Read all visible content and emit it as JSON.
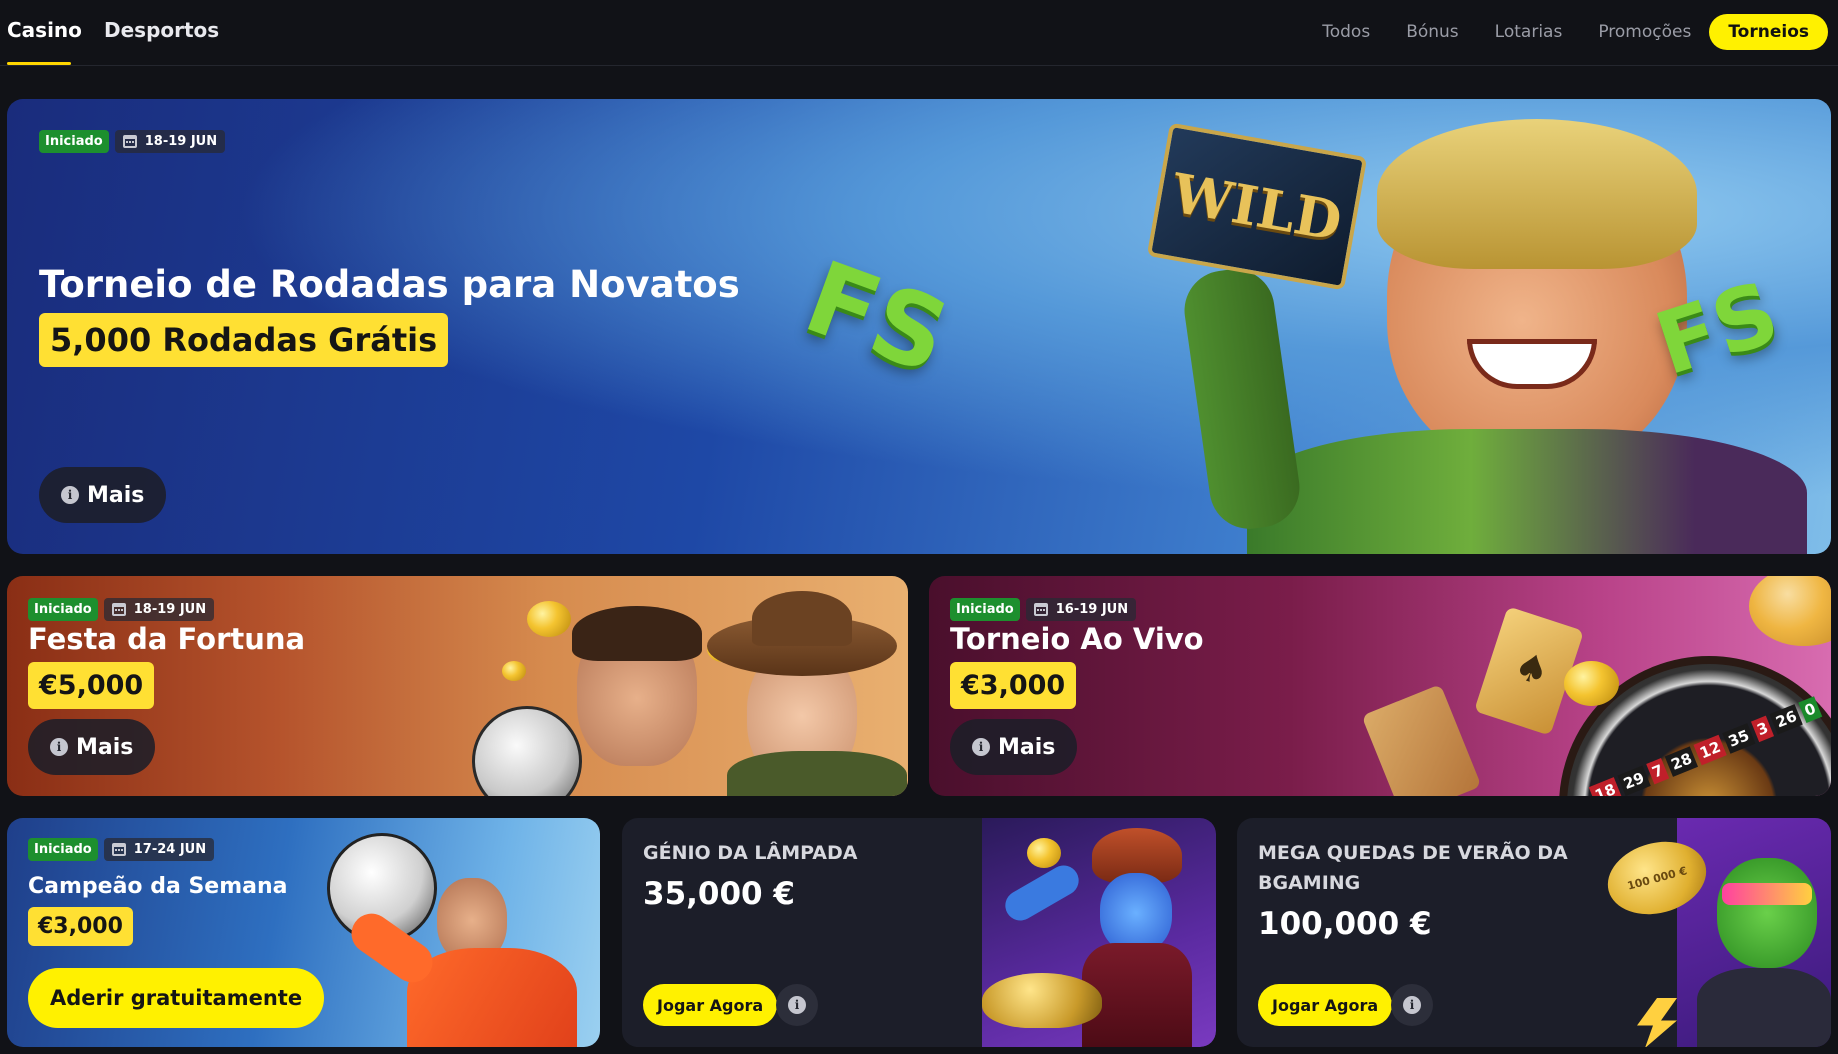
{
  "nav": {
    "main_tabs": [
      "Casino",
      "Desportos"
    ],
    "filters": [
      "Todos",
      "Bónus",
      "Lotarias",
      "Promoções",
      "Torneios"
    ],
    "active_filter": "Torneios",
    "active_main_tab": "Casino"
  },
  "hero": {
    "status": "Iniciado",
    "dates": "18-19 JUN",
    "title": "Torneio de Rodadas para Novatos",
    "prize": "5,000 Rodadas Grátis",
    "more_label": "Mais",
    "art_text": [
      "WILD",
      "FS",
      "FS"
    ]
  },
  "festa": {
    "status": "Iniciado",
    "dates": "18-19 JUN",
    "title": "Festa da Fortuna",
    "prize": "€5,000",
    "more_label": "Mais"
  },
  "vivo": {
    "status": "Iniciado",
    "dates": "16-19 JUN",
    "title": "Torneio Ao Vivo",
    "prize": "€3,000",
    "more_label": "Mais",
    "roulette_numbers": [
      "18",
      "29",
      "7",
      "28",
      "12",
      "35",
      "3",
      "26",
      "0"
    ]
  },
  "campeao": {
    "status": "Iniciado",
    "dates": "17-24 JUN",
    "title": "Campeão da Semana",
    "prize": "€3,000",
    "join_label": "Aderir gratuitamente"
  },
  "genio": {
    "title": "GÉNIO DA LÂMPADA",
    "amount": "35,000 €",
    "play_label": "Jogar Agora"
  },
  "mega": {
    "title": "MEGA QUEDAS DE VERÃO DA BGAMING",
    "amount": "100,000 €",
    "play_label": "Jogar Agora",
    "art_text": "100 000 €"
  },
  "colors": {
    "accent_yellow": "#fff100",
    "prize_yellow": "#ffe033",
    "status_green": "#1d8f2e",
    "background": "#111217",
    "dark_card": "#1c1e29"
  },
  "icons": [
    "calendar-icon",
    "info-icon"
  ]
}
